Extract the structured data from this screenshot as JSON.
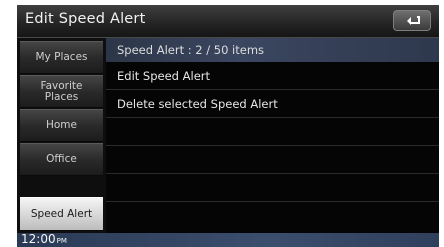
{
  "window": {
    "title": "Edit Speed Alert",
    "back_icon": "return-arrow-icon"
  },
  "list": {
    "header": "Speed Alert : 2 / 50 items",
    "items": [
      "Edit Speed Alert",
      "Delete selected Speed Alert"
    ]
  },
  "sidebar": {
    "items": [
      {
        "label": "My Places"
      },
      {
        "label": "Favorite\nPlaces"
      },
      {
        "label": "Home"
      },
      {
        "label": "Office"
      },
      {
        "label": "Speed Alert",
        "active": true
      }
    ]
  },
  "status": {
    "time": "12:00",
    "ampm": "PM"
  }
}
